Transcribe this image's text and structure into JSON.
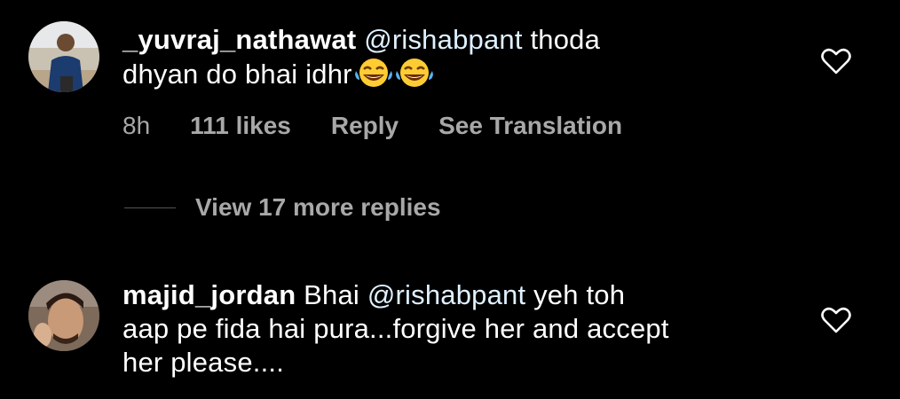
{
  "comments": [
    {
      "username": "_yuvraj_nathawat",
      "mention": "@rishabpant",
      "text_line1_rest": " thoda",
      "text_line2": "dhyan do bhai idhr",
      "emojis": [
        "face-with-tears-of-joy-icon",
        "face-with-tears-of-joy-icon"
      ],
      "time": "8h",
      "likes": "111 likes",
      "reply": "Reply",
      "translate": "See Translation",
      "icon": "heart-icon"
    },
    {
      "username": "majid_jordan",
      "prefix": "Bhai ",
      "mention": "@rishabpant",
      "text_line1_rest": " yeh toh",
      "text_line2": "aap pe fida hai pura...forgive her and accept",
      "text_line3": "her please....",
      "icon": "heart-icon"
    }
  ],
  "view_replies": "View 17 more replies",
  "colors": {
    "background": "#000000",
    "text": "#ffffff",
    "meta": "#a8a8a8"
  }
}
